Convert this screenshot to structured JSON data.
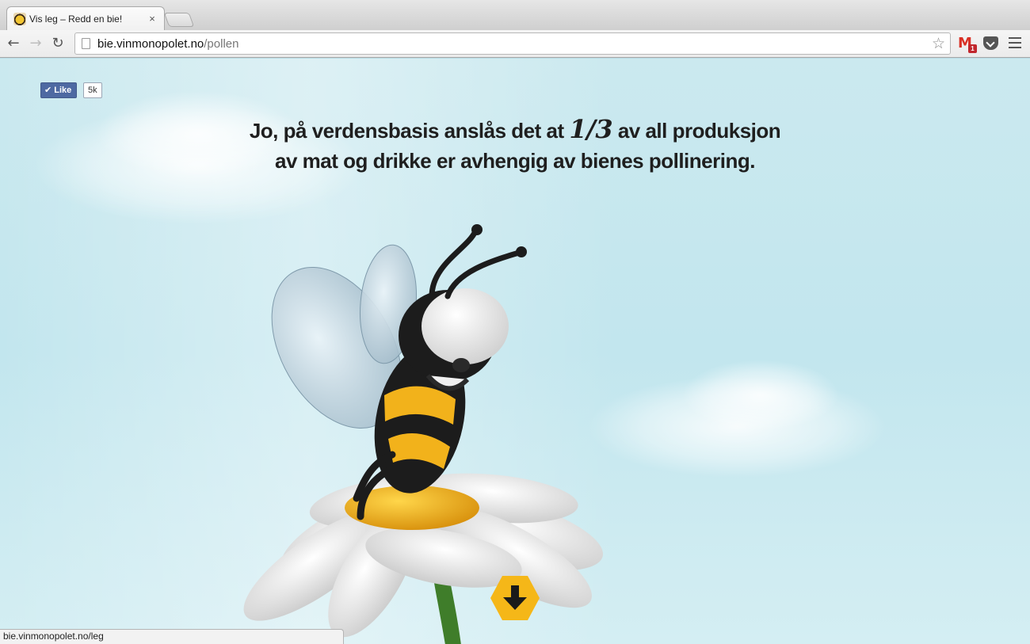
{
  "browser": {
    "tab_title": "Vis leg – Redd en bie!",
    "tab_close": "×",
    "url_domain": "bie.vinmonopolet.no",
    "url_path": "/pollen",
    "gmail_badge": "1",
    "status_url": "bie.vinmonopolet.no/leg",
    "icons": {
      "back": "back-arrow-icon",
      "forward": "forward-arrow-icon",
      "reload": "reload-icon",
      "bookmark": "star-icon",
      "gmail": "gmail-icon",
      "pocket": "pocket-icon",
      "menu": "hamburger-menu-icon"
    }
  },
  "page": {
    "like_label": "Like",
    "like_count": "5k",
    "headline_part1": "Jo, på verdensbasis anslås det at ",
    "headline_fraction": "1/3",
    "headline_part2": " av all produksjon av mat og drikke er avhengig av bienes pollinering.",
    "colors": {
      "sky": "#c2e6ee",
      "button_yellow": "#f5b718",
      "facebook_blue": "#4e69a2",
      "bee_yellow": "#f2b21b"
    }
  }
}
